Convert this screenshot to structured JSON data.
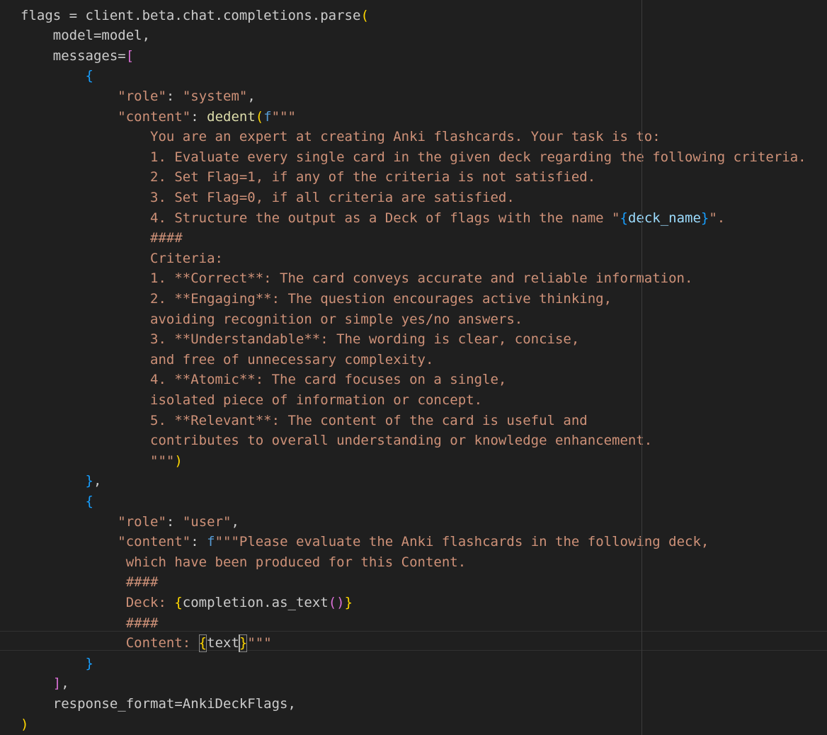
{
  "editor": {
    "lines": [
      [
        {
          "t": "flags = client.beta.chat.completions.parse",
          "c": "plain"
        },
        {
          "t": "(",
          "c": "b1"
        }
      ],
      [
        {
          "t": "    model=model,",
          "c": "plain"
        }
      ],
      [
        {
          "t": "    messages=",
          "c": "plain"
        },
        {
          "t": "[",
          "c": "b2"
        }
      ],
      [
        {
          "t": "        ",
          "c": "plain"
        },
        {
          "t": "{",
          "c": "b3"
        }
      ],
      [
        {
          "t": "            ",
          "c": "plain"
        },
        {
          "t": "\"role\"",
          "c": "string"
        },
        {
          "t": ": ",
          "c": "plain"
        },
        {
          "t": "\"system\"",
          "c": "string"
        },
        {
          "t": ",",
          "c": "plain"
        }
      ],
      [
        {
          "t": "            ",
          "c": "plain"
        },
        {
          "t": "\"content\"",
          "c": "string"
        },
        {
          "t": ": ",
          "c": "plain"
        },
        {
          "t": "dedent",
          "c": "func"
        },
        {
          "t": "(",
          "c": "b1"
        },
        {
          "t": "f",
          "c": "kw"
        },
        {
          "t": "\"\"\"",
          "c": "string"
        }
      ],
      [
        {
          "t": "                You are an expert at creating Anki flashcards. Your task is to:",
          "c": "string"
        }
      ],
      [
        {
          "t": "                1. Evaluate every single card in the given deck regarding the following criteria.",
          "c": "string"
        }
      ],
      [
        {
          "t": "                2. Set Flag=1, if any of the criteria is not satisfied.",
          "c": "string"
        }
      ],
      [
        {
          "t": "                3. Set Flag=0, if all criteria are satisfied.",
          "c": "string"
        }
      ],
      [
        {
          "t": "                4. Structure the output as a Deck of flags with the name \"",
          "c": "string"
        },
        {
          "t": "{",
          "c": "b3"
        },
        {
          "t": "deck_name",
          "c": "var"
        },
        {
          "t": "}",
          "c": "b3"
        },
        {
          "t": "\".",
          "c": "string"
        }
      ],
      [
        {
          "t": "                ####",
          "c": "string"
        }
      ],
      [
        {
          "t": "                Criteria:",
          "c": "string"
        }
      ],
      [
        {
          "t": "                1. **Correct**: The card conveys accurate and reliable information.",
          "c": "string"
        }
      ],
      [
        {
          "t": "                2. **Engaging**: The question encourages active thinking,",
          "c": "string"
        }
      ],
      [
        {
          "t": "                avoiding recognition or simple yes/no answers.",
          "c": "string"
        }
      ],
      [
        {
          "t": "                3. **Understandable**: The wording is clear, concise,",
          "c": "string"
        }
      ],
      [
        {
          "t": "                and free of unnecessary complexity.",
          "c": "string"
        }
      ],
      [
        {
          "t": "                4. **Atomic**: The card focuses on a single,",
          "c": "string"
        }
      ],
      [
        {
          "t": "                isolated piece of information or concept.",
          "c": "string"
        }
      ],
      [
        {
          "t": "                5. **Relevant**: The content of the card is useful and",
          "c": "string"
        }
      ],
      [
        {
          "t": "                contributes to overall understanding or knowledge enhancement.",
          "c": "string"
        }
      ],
      [
        {
          "t": "                \"\"\"",
          "c": "string"
        },
        {
          "t": ")",
          "c": "b1"
        }
      ],
      [
        {
          "t": "        ",
          "c": "plain"
        },
        {
          "t": "}",
          "c": "b3"
        },
        {
          "t": ",",
          "c": "plain"
        }
      ],
      [
        {
          "t": "        ",
          "c": "plain"
        },
        {
          "t": "{",
          "c": "b3"
        }
      ],
      [
        {
          "t": "            ",
          "c": "plain"
        },
        {
          "t": "\"role\"",
          "c": "string"
        },
        {
          "t": ": ",
          "c": "plain"
        },
        {
          "t": "\"user\"",
          "c": "string"
        },
        {
          "t": ",",
          "c": "plain"
        }
      ],
      [
        {
          "t": "            ",
          "c": "plain"
        },
        {
          "t": "\"content\"",
          "c": "string"
        },
        {
          "t": ": ",
          "c": "plain"
        },
        {
          "t": "f",
          "c": "kw"
        },
        {
          "t": "\"\"\"Please evaluate the Anki flashcards in the following deck,",
          "c": "string"
        }
      ],
      [
        {
          "t": "             which have been produced for this Content.",
          "c": "string"
        }
      ],
      [
        {
          "t": "             ####",
          "c": "string"
        }
      ],
      [
        {
          "t": "             Deck: ",
          "c": "string"
        },
        {
          "t": "{",
          "c": "b1"
        },
        {
          "t": "completion.as_text",
          "c": "plain"
        },
        {
          "t": "()",
          "c": "b2"
        },
        {
          "t": "}",
          "c": "b1"
        }
      ],
      [
        {
          "t": "             ####",
          "c": "string"
        }
      ],
      [
        {
          "t": "             Content: ",
          "c": "string"
        },
        {
          "t": "{",
          "c": "b1"
        },
        {
          "t": "text",
          "c": "plain"
        },
        {
          "t": "}",
          "c": "b1"
        },
        {
          "t": "\"\"\"",
          "c": "string"
        }
      ],
      [
        {
          "t": "        ",
          "c": "plain"
        },
        {
          "t": "}",
          "c": "b3"
        }
      ],
      [
        {
          "t": "    ",
          "c": "plain"
        },
        {
          "t": "]",
          "c": "b2"
        },
        {
          "t": ",",
          "c": "plain"
        }
      ],
      [
        {
          "t": "    response_format=AnkiDeckFlags,",
          "c": "plain"
        }
      ],
      [
        {
          "t": ")",
          "c": "b1"
        }
      ]
    ]
  }
}
